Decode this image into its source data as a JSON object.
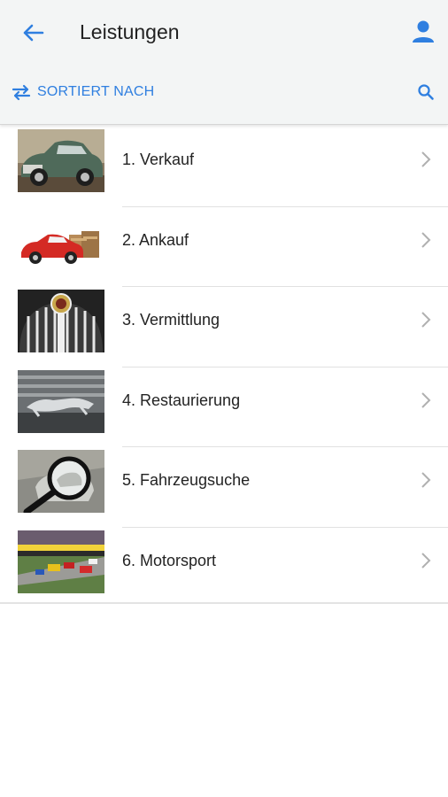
{
  "header": {
    "title": "Leistungen",
    "sort_label": "SORTIERT NACH",
    "accent_color": "#2f7fe0"
  },
  "services": [
    {
      "label": "1. Verkauf",
      "thumb": "green-classic-car"
    },
    {
      "label": "2. Ankauf",
      "thumb": "red-toy-car-with-money"
    },
    {
      "label": "3. Vermittlung",
      "thumb": "chrome-grille-emblem"
    },
    {
      "label": "4. Restaurierung",
      "thumb": "jaguar-leaper-ornament"
    },
    {
      "label": "5. Fahrzeugsuche",
      "thumb": "magnifier-over-car"
    },
    {
      "label": "6. Motorsport",
      "thumb": "racing-track"
    }
  ]
}
